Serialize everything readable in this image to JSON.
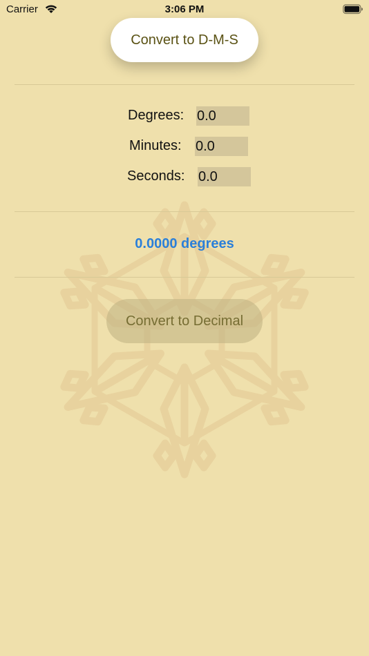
{
  "status_bar": {
    "carrier": "Carrier",
    "time": "3:06 PM",
    "wifi_icon": "wifi-icon",
    "battery_icon": "battery-icon"
  },
  "buttons": {
    "convert_dms": "Convert to D-M-S",
    "convert_decimal": "Convert to Decimal"
  },
  "fields": {
    "degrees": {
      "label": "Degrees:",
      "value": "0.0"
    },
    "minutes": {
      "label": "Minutes:",
      "value": "0.0"
    },
    "seconds": {
      "label": "Seconds:",
      "value": "0.0"
    }
  },
  "result": "0.0000 degrees",
  "colors": {
    "background": "#efe0ac",
    "result_text": "#2a7fd9",
    "button_text": "#5a5214",
    "input_background": "#d4c69b"
  }
}
